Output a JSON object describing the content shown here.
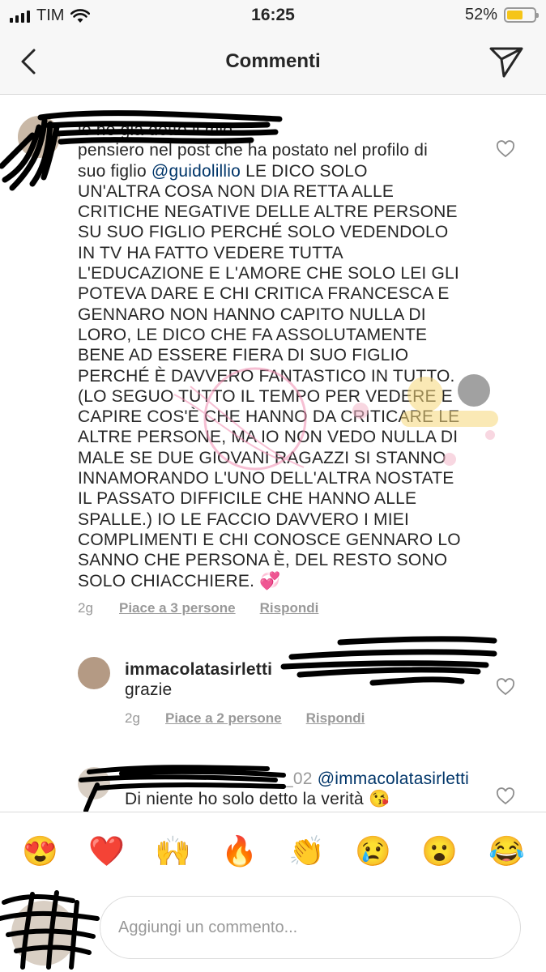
{
  "status_bar": {
    "carrier": "TIM",
    "time": "16:25",
    "battery_percent": "52%",
    "battery_level": 0.52,
    "battery_color": "#f5c518"
  },
  "navbar": {
    "back_icon": "chevron-left-icon",
    "title": "Commenti",
    "send_icon": "paper-plane-icon"
  },
  "comments": [
    {
      "username_hidden": true,
      "text_before_mention": "io ho già detto il mio\npensiero nel post che ha postato nel profilo di\nsuo figlio ",
      "mention": "@guidolillio",
      "text_after_mention": " LE DICO SOLO\nUN'ALTRA COSA NON DIA RETTA ALLE\nCRITICHE NEGATIVE DELLE ALTRE PERSONE\nSU SUO FIGLIO PERCHÉ SOLO VEDENDOLO\nIN TV HA FATTO VEDERE TUTTA\nL'EDUCAZIONE E L'AMORE CHE SOLO LEI GLI\nPOTEVA DARE E CHI CRITICA FRANCESCA E\nGENNARO NON HANNO CAPITO NULLA DI\nLORO, LE DICO CHE FA ASSOLUTAMENTE\nBENE AD ESSERE FIERA DI SUO FIGLIO\nPERCHÉ È DAVVERO FANTASTICO IN TUTTO.\n(LO SEGUO TUTTO IL TEMPO PER VEDERE E\nCAPIRE COS'È CHE HANNO DA CRITICARE LE\nALTRE PERSONE, MA IO NON VEDO NULLA DI\nMALE SE DUE GIOVANI RAGAZZI SI STANNO\nINNAMORANDO L'UNO DELL'ALTRA NOSTATE\nIL PASSATO DIFFICILE CHE HANNO ALLE\nSPALLE.) IO LE FACCIO DAVVERO I MIEI\nCOMPLIMENTI E CHI CONOSCE GENNARO LO\nSANNO CHE PERSONA È, DEL RESTO SONO\nSOLO CHIACCHIERE. 💞",
      "time": "2g",
      "likes": "Piace a 3 persone",
      "reply": "Rispondi"
    },
    {
      "username": "immacolatasirletti",
      "text": "grazie",
      "time": "2g",
      "likes": "Piace a 2 persone",
      "reply": "Rispondi"
    },
    {
      "username_hidden": true,
      "username_partial": "_02",
      "mention": "@immacolatasirletti",
      "text": "Di niente ho solo detto la verità 😘"
    }
  ],
  "emoji_bar": [
    "😍",
    "❤️",
    "🙌",
    "🔥",
    "👏",
    "😢",
    "😮",
    "😂"
  ],
  "composer": {
    "placeholder": "Aggiungi un commento..."
  }
}
